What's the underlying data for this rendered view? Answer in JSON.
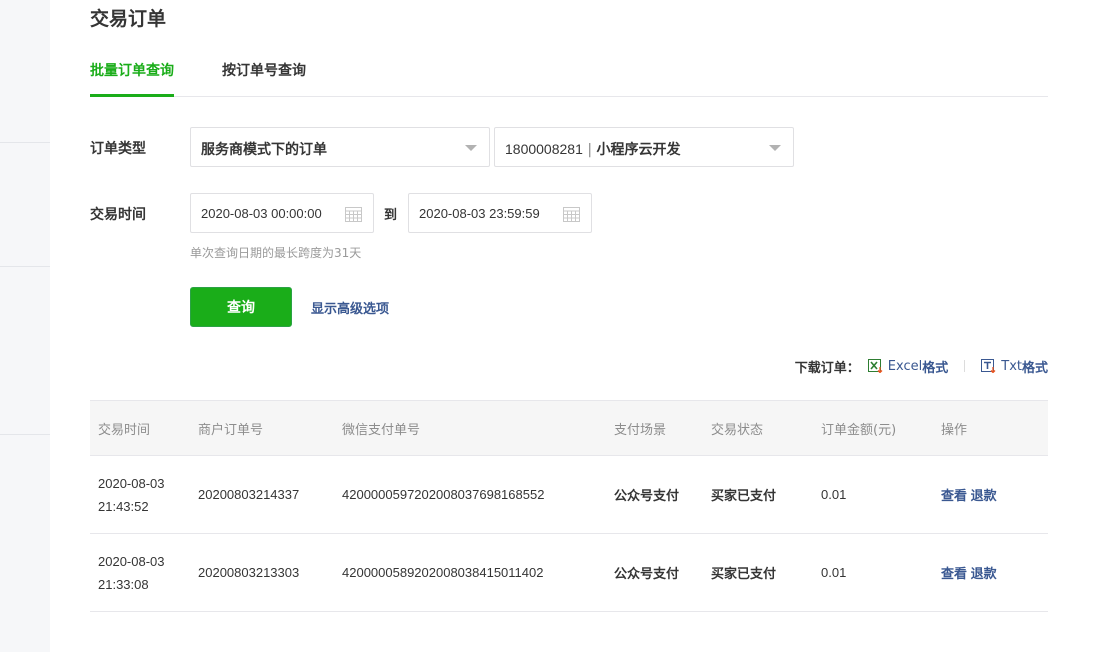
{
  "page": {
    "title": "交易订单"
  },
  "tabs": [
    {
      "label": "批量订单查询",
      "active": true
    },
    {
      "label": "按订单号查询",
      "active": false
    }
  ],
  "form": {
    "order_type_label": "订单类型",
    "order_type_value": "服务商模式下的订单",
    "appid_value": "1800008281",
    "app_name": "小程序云开发",
    "time_label": "交易时间",
    "start_time": "2020-08-03 00:00:00",
    "to_label": "到",
    "end_time": "2020-08-03 23:59:59",
    "hint": "单次查询日期的最长跨度为31天",
    "query_button": "查询",
    "advanced_link": "显示高级选项"
  },
  "download": {
    "label": "下载订单：",
    "excel_prefix": "Excel",
    "excel_suffix": "格式",
    "txt_prefix": "Txt",
    "txt_suffix": "格式"
  },
  "table": {
    "headers": [
      "交易时间",
      "商户订单号",
      "微信支付单号",
      "支付场景",
      "交易状态",
      "订单金额(元)",
      "操作"
    ],
    "rows": [
      {
        "date": "2020-08-03",
        "time": "21:43:52",
        "merchant_no": "20200803214337",
        "wechat_no": "4200000597202008037698168552",
        "scene": "公众号支付",
        "status": "买家已支付",
        "amount": "0.01",
        "view": "查看",
        "refund": "退款"
      },
      {
        "date": "2020-08-03",
        "time": "21:33:08",
        "merchant_no": "20200803213303",
        "wechat_no": "4200000589202008038415011402",
        "scene": "公众号支付",
        "status": "买家已支付",
        "amount": "0.01",
        "view": "查看",
        "refund": "退款"
      }
    ]
  },
  "colors": {
    "accent": "#1aad19",
    "link": "#3a5891"
  }
}
